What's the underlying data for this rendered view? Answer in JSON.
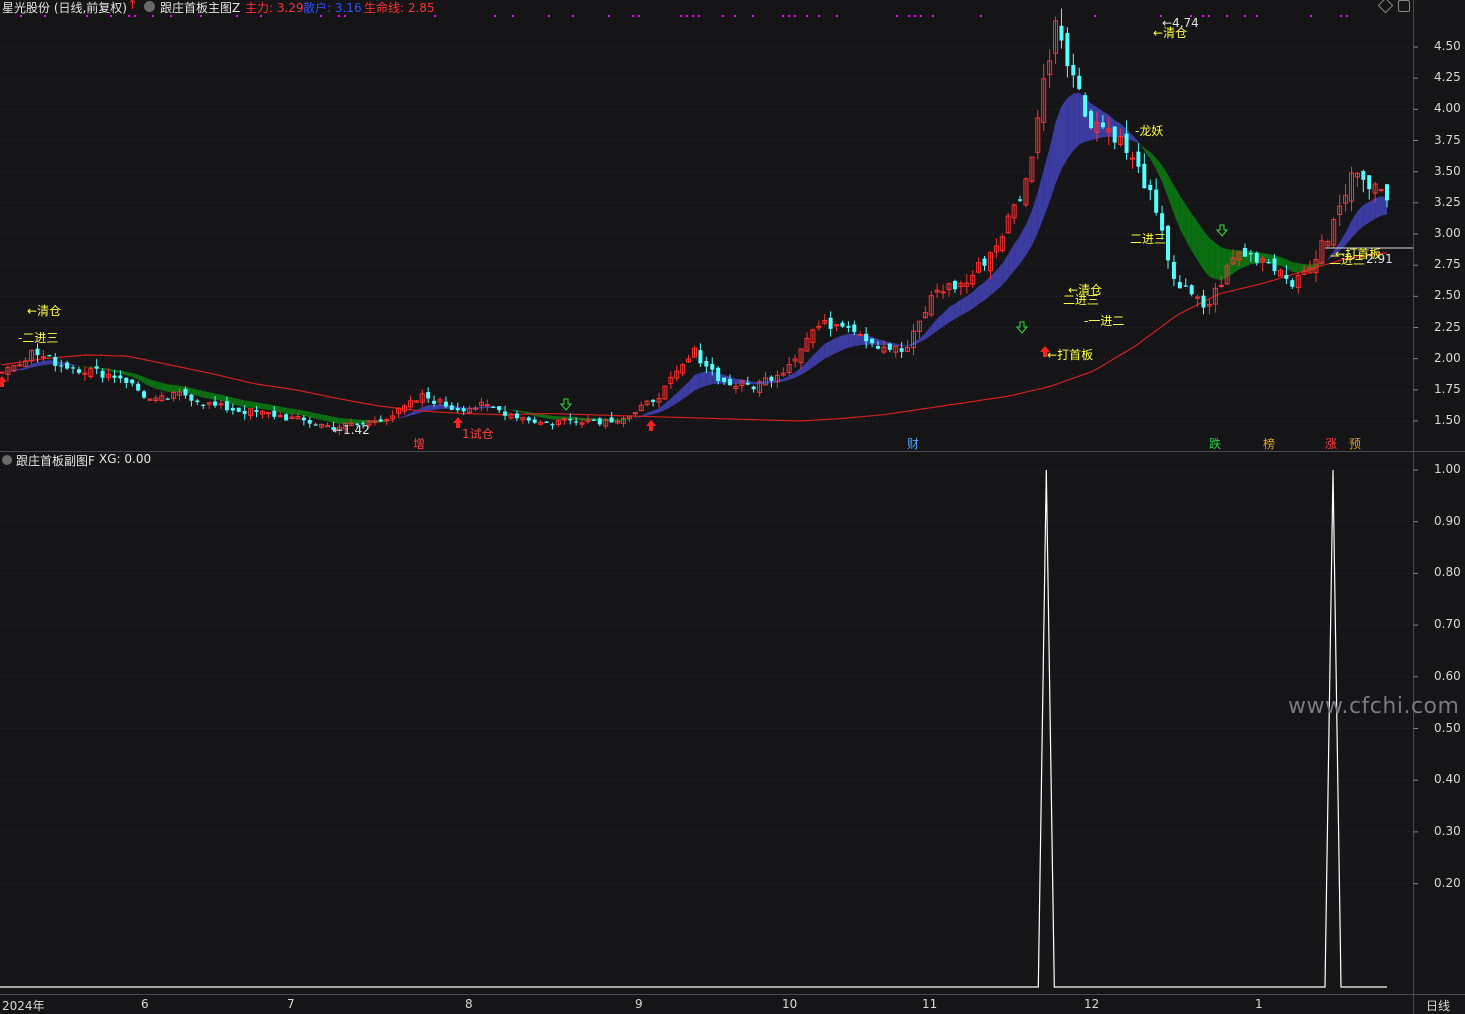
{
  "main_header": {
    "stock": "星光股份 (日线,前复权)",
    "indicator": "跟庄首板主图Z",
    "zhuli": "主力: 3.29",
    "sanhu": "散户: 3.16",
    "shengming": "生命线: 2.85"
  },
  "sub_header": {
    "indicator": "跟庄首板副图F",
    "xg": "XG: 0.00"
  },
  "main_axis_ticks": [
    "4.50",
    "4.25",
    "4.00",
    "3.75",
    "3.50",
    "3.25",
    "3.00",
    "2.75",
    "2.50",
    "2.25",
    "2.00",
    "1.75",
    "1.50"
  ],
  "sub_axis_ticks": [
    "1.00",
    "0.90",
    "0.80",
    "0.70",
    "0.60",
    "0.50",
    "0.40",
    "0.30",
    "0.20"
  ],
  "date_labels": [
    "2024年",
    "6",
    "7",
    "8",
    "9",
    "10",
    "11",
    "12",
    "1"
  ],
  "period_button": "日线",
  "bottom_tags": [
    {
      "text": "增",
      "color": "#ff4040"
    },
    {
      "text": "财",
      "color": "#50a8ff"
    },
    {
      "text": "跌",
      "color": "#20d040"
    },
    {
      "text": "榜",
      "color": "#e0a020"
    },
    {
      "text": "涨",
      "color": "#ff4040"
    },
    {
      "text": "预",
      "color": "#e0a020"
    }
  ],
  "annotations": {
    "qingcang_left": "清仓",
    "erjinsan_left": "二进三",
    "low_value": "1.42",
    "shicang": "1试仓",
    "high_value": "4.74",
    "qingcang_top": "清仓",
    "longyao": "龙妖",
    "erjinsan_mid": "二进三",
    "qingcang_mid": "清仓",
    "erjinsan_small": "二进三",
    "yijiner": "一进二",
    "dashouban": "打首板",
    "dashouban_right": "打首板",
    "erjinsan_right": "二进三",
    "right_value": "2.91"
  },
  "watermark": "www.cfchi.com",
  "colors": {
    "background": "#151417",
    "up_candle": "#ff3030",
    "down_candle": "#54ffff",
    "life_line": "#d02020",
    "band_up": "#3c3ca0",
    "band_down": "#0b6e12",
    "signal_line": "#ffffff",
    "marker": "#ff00ff",
    "annotation": "#ffff40"
  },
  "chart_data": [
    {
      "type": "candlestick",
      "ylim": [
        1.4,
        4.75
      ],
      "x_months": [
        "2024年",
        "6",
        "7",
        "8",
        "9",
        "10",
        "11",
        "12",
        "1"
      ],
      "approx_close_path": [
        1.9,
        2.05,
        1.95,
        1.9,
        1.85,
        1.65,
        1.72,
        1.62,
        1.58,
        1.55,
        1.5,
        1.45,
        1.48,
        1.55,
        1.7,
        1.6,
        1.62,
        1.55,
        1.48,
        1.52,
        1.5,
        1.55,
        1.75,
        2.05,
        1.8,
        1.78,
        1.92,
        2.25,
        2.3,
        2.12,
        2.05,
        2.55,
        2.6,
        2.9,
        3.4,
        4.74,
        3.95,
        3.8,
        3.4,
        2.6,
        2.4,
        2.85,
        2.8,
        2.6,
        2.95,
        3.55,
        3.25
      ],
      "life_line_path": [
        1.95,
        2.0,
        2.03,
        2.02,
        1.95,
        1.88,
        1.8,
        1.75,
        1.68,
        1.62,
        1.58,
        1.56,
        1.55,
        1.56,
        1.55,
        1.54,
        1.53,
        1.52,
        1.51,
        1.5,
        1.52,
        1.55,
        1.6,
        1.65,
        1.7,
        1.78,
        1.9,
        2.1,
        2.35,
        2.52,
        2.6,
        2.7,
        2.8,
        2.85
      ],
      "high_label": 4.74,
      "low_label": 1.42,
      "last_label": 2.91
    },
    {
      "type": "line",
      "name": "XG",
      "ylim": [
        0,
        1.0
      ],
      "spikes_at_fraction": [
        0.754,
        0.961
      ],
      "value_at_spike": 1.0
    }
  ]
}
